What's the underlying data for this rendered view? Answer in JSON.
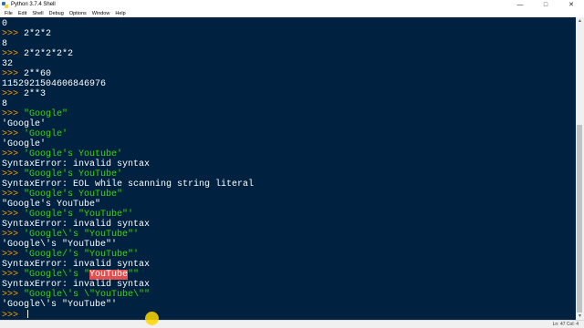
{
  "window": {
    "title": "Python 3.7.4 Shell",
    "minimize_glyph": "—",
    "maximize_glyph": "□",
    "close_glyph": "✕"
  },
  "menu": [
    "File",
    "Edit",
    "Shell",
    "Debug",
    "Options",
    "Window",
    "Help"
  ],
  "shell": {
    "prompt": ">>> ",
    "lines": [
      [
        "0"
      ],
      [
        ">>> ",
        "2*2*2"
      ],
      [
        "8"
      ],
      [
        ">>> ",
        "2*2*2*2*2"
      ],
      [
        "32"
      ],
      [
        ">>> ",
        "2**60"
      ],
      [
        "1152921504606846976"
      ],
      [
        ">>> ",
        "2**3"
      ],
      [
        "8"
      ],
      [
        ">>> ",
        "\"Google\""
      ],
      [
        "'Google'"
      ],
      [
        ">>> ",
        "'Google'"
      ],
      [
        "'Google'"
      ],
      [
        ">>> ",
        "'Google's Youtube'"
      ],
      [
        "SyntaxError: invalid syntax"
      ],
      [
        ">>> ",
        "\"Google's YouTube'"
      ],
      [
        "SyntaxError: EOL while scanning string literal"
      ],
      [
        ">>> ",
        "\"Google's YouTube\""
      ],
      [
        "\"Google's YouTube\""
      ],
      [
        ">>> ",
        "'Google's \"YouTube\"'"
      ],
      [
        "SyntaxError: invalid syntax"
      ],
      [
        ">>> ",
        "'Google\\'s \"YouTube\"'"
      ],
      [
        "'Google\\'s \"YouTube\"'"
      ],
      [
        ">>> ",
        "'Google/'s \"YouTube\"'"
      ],
      [
        "SyntaxError: invalid syntax"
      ],
      [
        ">>> ",
        "\"Google\\'s \"",
        "YouTube",
        "\"\""
      ],
      [
        "SyntaxError: invalid syntax"
      ],
      [
        ">>> ",
        "\"Google\\'s \\\"YouTube\\\"\""
      ],
      [
        "'Google\\'s \"YouTube\"'"
      ],
      [
        ">>> "
      ]
    ]
  },
  "status": {
    "position": "Ln: 47  Col: 4"
  },
  "scrollbar": {
    "up_glyph": "▲",
    "down_glyph": "▼"
  },
  "colors": {
    "shell_background": "#002240",
    "prompt": "#ff9d00",
    "string_input": "#3ad900",
    "output": "#ffffff",
    "highlight": "#e05050"
  }
}
